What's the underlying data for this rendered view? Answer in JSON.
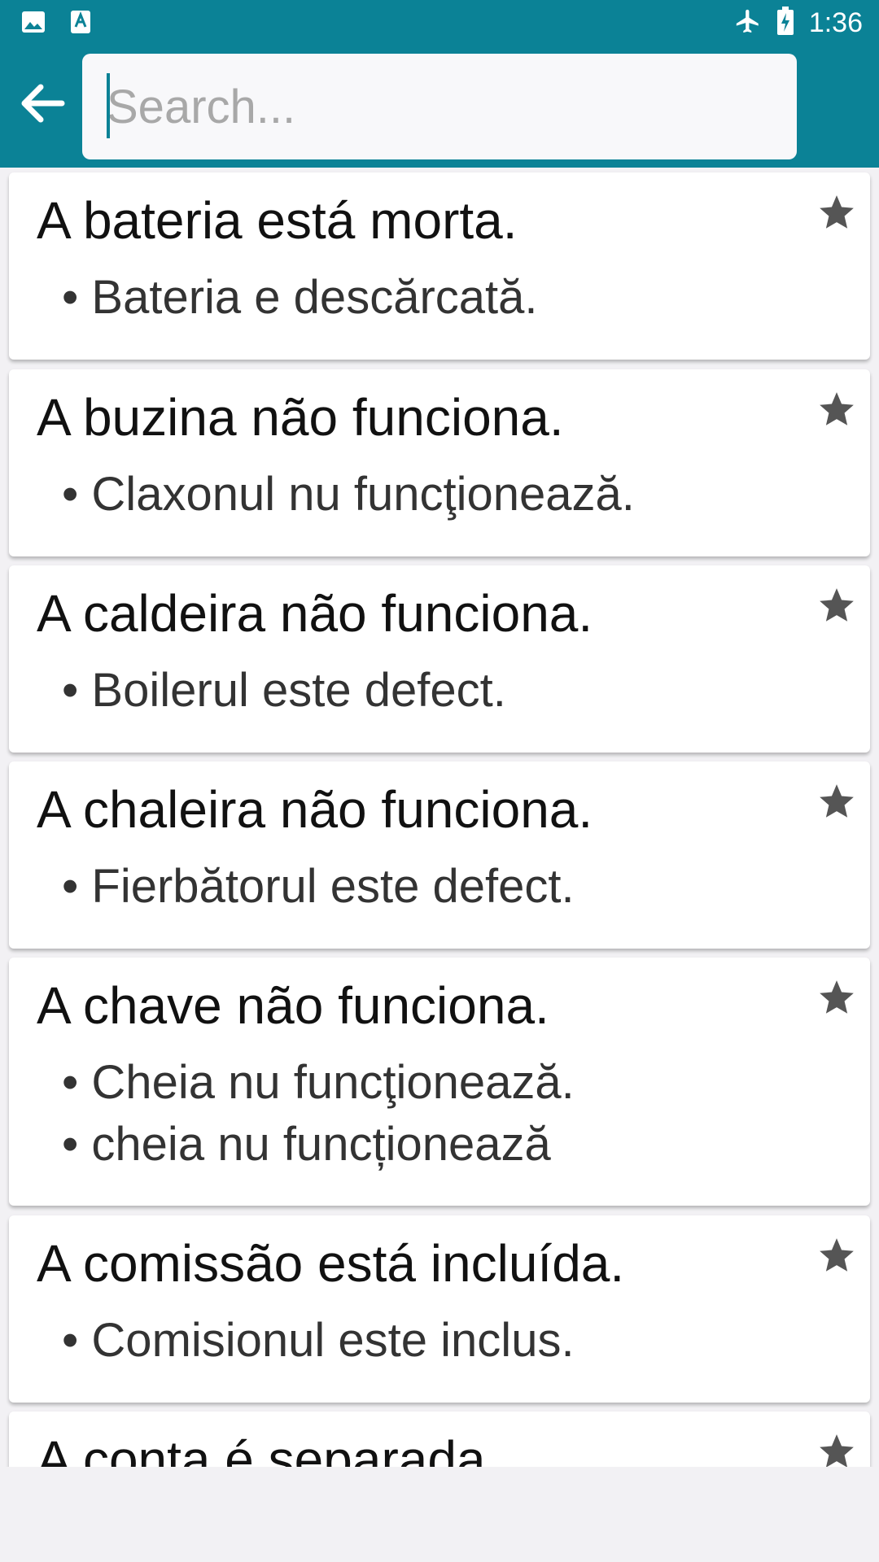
{
  "status_bar": {
    "time": "1:36",
    "left_icons": [
      "image-icon",
      "text-a-icon"
    ],
    "right_icons": [
      "airplane-icon",
      "battery-charging-icon"
    ]
  },
  "toolbar": {
    "back_icon": "arrow-left-icon",
    "search_placeholder": "Search...",
    "search_value": ""
  },
  "colors": {
    "primary": "#0b8296",
    "card": "#ffffff",
    "background": "#f2f1f4",
    "star": "#555555"
  },
  "phrases": [
    {
      "title": "A bateria está morta.",
      "translations": [
        "Bateria e descărcată."
      ]
    },
    {
      "title": "A buzina não funciona.",
      "translations": [
        "Claxonul nu funcţionează."
      ]
    },
    {
      "title": "A caldeira não funciona.",
      "translations": [
        "Boilerul este defect."
      ]
    },
    {
      "title": "A chaleira não funciona.",
      "translations": [
        "Fierbătorul este defect."
      ]
    },
    {
      "title": "A chave não funciona.",
      "translations": [
        "Cheia nu funcţionează.",
        "cheia nu funcționează"
      ]
    },
    {
      "title": "A comissão está incluída.",
      "translations": [
        "Comisionul este inclus."
      ]
    },
    {
      "title": "A conta é separada.",
      "translations": []
    }
  ],
  "star_icon": "star-icon"
}
